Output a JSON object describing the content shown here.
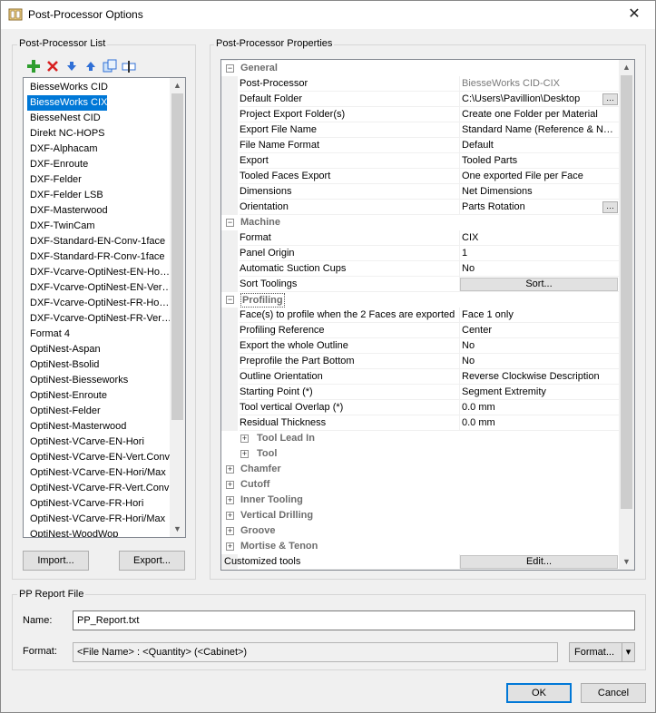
{
  "window": {
    "title": "Post-Processor Options",
    "close_glyph": "✕"
  },
  "list_group": {
    "label": "Post-Processor List",
    "toolbar_icons": [
      "add-icon",
      "delete-icon",
      "move-down-icon",
      "move-up-icon",
      "copy-icon",
      "rename-icon"
    ],
    "items": [
      "BiesseWorks CID",
      "BiesseWorks CIX",
      "BiesseNest CID",
      "Direkt NC-HOPS",
      "DXF-Alphacam",
      "DXF-Enroute",
      "DXF-Felder",
      "DXF-Felder LSB",
      "DXF-Masterwood",
      "DXF-TwinCam",
      "DXF-Standard-EN-Conv-1face",
      "DXF-Standard-FR-Conv-1face",
      "DXF-Vcarve-OptiNest-EN-Ho…",
      "DXF-Vcarve-OptiNest-EN-Ver…",
      "DXF-Vcarve-OptiNest-FR-Ho…",
      "DXF-Vcarve-OptiNest-FR-Ver…",
      "Format 4",
      "OptiNest-Aspan",
      "OptiNest-Bsolid",
      "OptiNest-Biesseworks",
      "OptiNest-Enroute",
      "OptiNest-Felder",
      "OptiNest-Masterwood",
      "OptiNest-VCarve-EN-Hori",
      "OptiNest-VCarve-EN-Vert.Conv",
      "OptiNest-VCarve-EN-Hori/Max",
      "OptiNest-VCarve-FR-Vert.Conv",
      "OptiNest-VCarve-FR-Hori",
      "OptiNest-VCarve-FR-Hori/Max",
      "OptiNest-WoodWop"
    ],
    "selected_index": 1,
    "import_label": "Import...",
    "export_label": "Export..."
  },
  "props_group": {
    "label": "Post-Processor Properties",
    "rows": [
      {
        "kind": "cat",
        "name": "General",
        "exp": "−",
        "indent": 0
      },
      {
        "kind": "prop",
        "name": "Post-Processor",
        "value": "BiesseWorks CID-CIX",
        "gray": true
      },
      {
        "kind": "prop",
        "name": "Default Folder",
        "value": "C:\\Users\\Pavillion\\Desktop",
        "dots": "…"
      },
      {
        "kind": "prop",
        "name": "Project Export Folder(s)",
        "value": "Create one Folder per Material"
      },
      {
        "kind": "prop",
        "name": "Export File Name",
        "value": "Standard Name (Reference & N…"
      },
      {
        "kind": "prop",
        "name": "File Name Format",
        "value": "Default"
      },
      {
        "kind": "prop",
        "name": "Export",
        "value": "Tooled Parts"
      },
      {
        "kind": "prop",
        "name": "Tooled Faces Export",
        "value": "One exported File per Face"
      },
      {
        "kind": "prop",
        "name": "Dimensions",
        "value": "Net Dimensions"
      },
      {
        "kind": "prop",
        "name": "Orientation",
        "value": "Parts Rotation",
        "dots": "…"
      },
      {
        "kind": "cat",
        "name": "Machine",
        "exp": "−",
        "indent": 0
      },
      {
        "kind": "prop",
        "name": "Format",
        "value": "CIX"
      },
      {
        "kind": "prop",
        "name": "Panel Origin",
        "value": "1"
      },
      {
        "kind": "prop",
        "name": "Automatic Suction Cups",
        "value": "No"
      },
      {
        "kind": "button",
        "name": "Sort Toolings",
        "button": "Sort..."
      },
      {
        "kind": "cat",
        "name": "Profiling",
        "exp": "−",
        "indent": 0,
        "boxed": true
      },
      {
        "kind": "prop",
        "name": "Face(s) to profile when the 2 Faces are exported",
        "value": "Face 1 only"
      },
      {
        "kind": "prop",
        "name": "Profiling Reference",
        "value": "Center"
      },
      {
        "kind": "prop",
        "name": "Export the whole Outline",
        "value": "No"
      },
      {
        "kind": "prop",
        "name": "Preprofile the Part Bottom",
        "value": "No"
      },
      {
        "kind": "prop",
        "name": "Outline Orientation",
        "value": "Reverse Clockwise Description"
      },
      {
        "kind": "prop",
        "name": "Starting Point (*)",
        "value": "Segment Extremity"
      },
      {
        "kind": "prop",
        "name": "Tool vertical Overlap (*)",
        "value": "0.0 mm"
      },
      {
        "kind": "prop",
        "name": "Residual Thickness",
        "value": "0.0 mm"
      },
      {
        "kind": "cat",
        "name": "Tool Lead In",
        "exp": "+",
        "indent": 1
      },
      {
        "kind": "cat",
        "name": "Tool",
        "exp": "+",
        "indent": 1
      },
      {
        "kind": "cat",
        "name": "Chamfer",
        "exp": "+",
        "indent": 0
      },
      {
        "kind": "cat",
        "name": "Cutoff",
        "exp": "+",
        "indent": 0
      },
      {
        "kind": "cat",
        "name": "Inner Tooling",
        "exp": "+",
        "indent": 0
      },
      {
        "kind": "cat",
        "name": "Vertical Drilling",
        "exp": "+",
        "indent": 0
      },
      {
        "kind": "cat",
        "name": "Groove",
        "exp": "+",
        "indent": 0
      },
      {
        "kind": "cat",
        "name": "Mortise & Tenon",
        "exp": "+",
        "indent": 0
      },
      {
        "kind": "button",
        "name": "Customized tools",
        "button": "Edit...",
        "noindent": true
      }
    ]
  },
  "report_group": {
    "label": "PP Report File",
    "name_label": "Name:",
    "name_value": "PP_Report.txt",
    "format_label": "Format:",
    "format_value": "<File Name> : <Quantity> (<Cabinet>)",
    "format_button": "Format...",
    "format_arrow": "▾"
  },
  "dialog": {
    "ok_label": "OK",
    "cancel_label": "Cancel"
  },
  "scroll_arrows": {
    "up": "▲",
    "down": "▼"
  }
}
